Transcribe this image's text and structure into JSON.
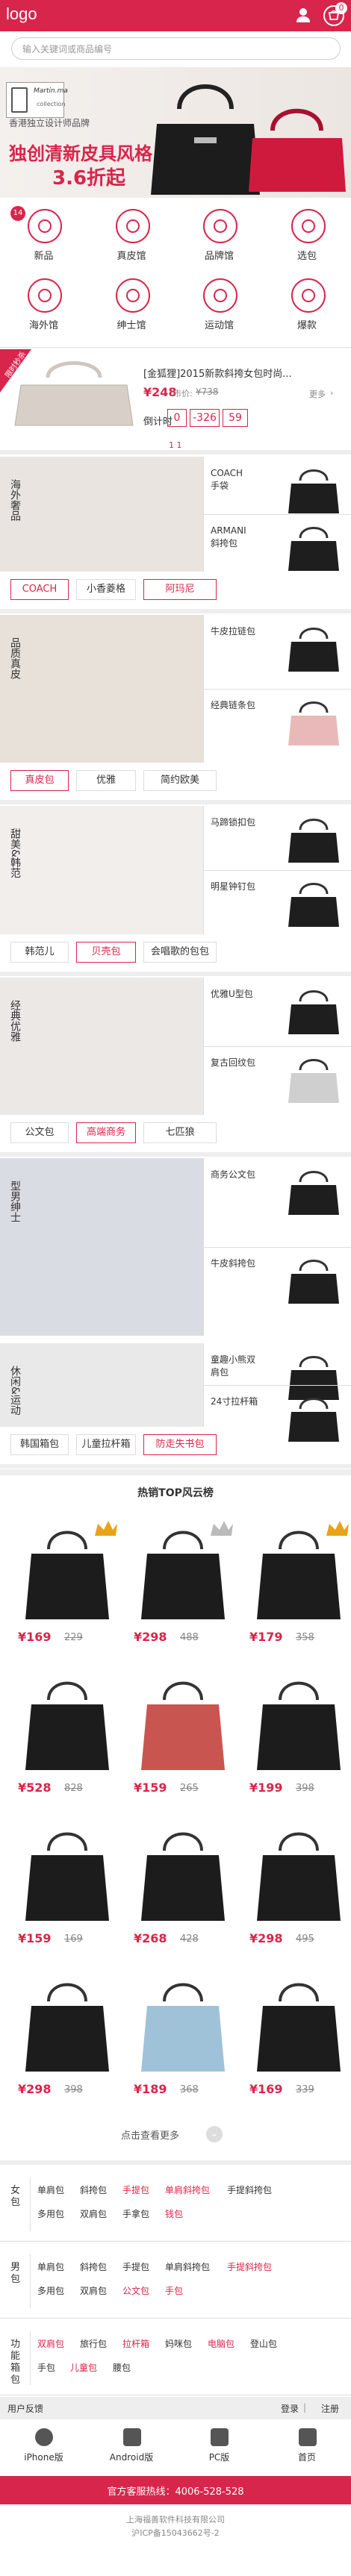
{
  "header": {
    "logo": "logo",
    "cart_count": "0",
    "search_placeholder": "输入关键词或商品编号"
  },
  "banner": {
    "brand_name": "Martin.ma",
    "brand_sub": "collection",
    "subtitle": "香港独立设计师品牌",
    "title": "独创清新皮具风格",
    "discount": "3.6折起"
  },
  "categories": [
    {
      "label": "新品",
      "badge": "14",
      "icon": "new-icon"
    },
    {
      "label": "真皮馆",
      "icon": "leather-bag-icon"
    },
    {
      "label": "品牌馆",
      "icon": "tag-icon"
    },
    {
      "label": "选包",
      "icon": "bag-select-icon"
    },
    {
      "label": "海外馆",
      "icon": "diamond-icon"
    },
    {
      "label": "绅士馆",
      "icon": "mustache-icon"
    },
    {
      "label": "运动馆",
      "icon": "sport-icon"
    },
    {
      "label": "爆款",
      "icon": "hot-icon"
    }
  ],
  "flash": {
    "tag": "限时秒杀",
    "title": "[金狐狸]2015新款斜挎女包时尚...",
    "price": "¥248",
    "old_price": "¥738",
    "more": "更多",
    "countdown_label": "倒计时",
    "countdown": [
      "0",
      "-326",
      "59"
    ],
    "pager": "1 1"
  },
  "blocks": [
    {
      "side": "海外奢品",
      "items": [
        {
          "name": "COACH\n手袋"
        },
        {
          "name": "ARMANI\n斜挎包"
        }
      ],
      "tags": [
        "COACH",
        "小香菱格",
        "阿玛尼"
      ],
      "active": [
        0,
        2
      ]
    },
    {
      "side": "品质真皮",
      "items": [
        {
          "name": "牛皮拉链包"
        },
        {
          "name": "经典链条包"
        }
      ],
      "tags": [
        "真皮包",
        "优雅",
        "简约欧美"
      ],
      "active": [
        0
      ]
    },
    {
      "side": "甜美&韩范",
      "items": [
        {
          "name": "马蹄锁扣包"
        },
        {
          "name": "明星钟钉包"
        }
      ],
      "tags": [
        "韩范儿",
        "贝壳包",
        "会唱歌的包包"
      ],
      "active": [
        1
      ]
    },
    {
      "side": "经典优雅",
      "items": [
        {
          "name": "优雅U型包"
        },
        {
          "name": "复古回纹包"
        }
      ],
      "tags": [
        "公文包",
        "高端商务",
        "七匹狼"
      ],
      "active": [
        1
      ]
    },
    {
      "side": "型男绅士",
      "items": [
        {
          "name": "商务公文包"
        },
        {
          "name": "牛皮斜挎包"
        }
      ],
      "tags": [],
      "active": []
    },
    {
      "side": "休闲&运动",
      "items": [
        {
          "name": "童趣小熊双肩包"
        },
        {
          "name": "24寸拉杆箱"
        }
      ],
      "tags": [
        "韩国箱包",
        "儿童拉杆箱",
        "防走失书包"
      ],
      "active": [
        2
      ]
    }
  ],
  "hot": {
    "title": "热销TOP风云榜",
    "products": [
      {
        "price": "¥169",
        "old": "229"
      },
      {
        "price": "¥298",
        "old": "488"
      },
      {
        "price": "¥179",
        "old": "358"
      },
      {
        "price": "¥528",
        "old": "828"
      },
      {
        "price": "¥159",
        "old": "265"
      },
      {
        "price": "¥199",
        "old": "398"
      },
      {
        "price": "¥159",
        "old": "169"
      },
      {
        "price": "¥268",
        "old": "428"
      },
      {
        "price": "¥298",
        "old": "495"
      },
      {
        "price": "¥298",
        "old": "398"
      },
      {
        "price": "¥189",
        "old": "368"
      },
      {
        "price": "¥169",
        "old": "339"
      }
    ],
    "more": "点击查看更多"
  },
  "footer_cats": [
    {
      "title": "女包",
      "links": [
        [
          "单肩包",
          "斜挎包",
          "手提包",
          "单肩斜挎包",
          "手提斜挎包"
        ],
        [
          "多用包",
          "双肩包",
          "手拿包",
          "钱包"
        ]
      ],
      "active": [
        [
          2,
          3
        ],
        [
          3
        ]
      ]
    },
    {
      "title": "男包",
      "links": [
        [
          "单肩包",
          "斜挎包",
          "手提包",
          "单肩斜挎包",
          "手提斜挎包"
        ],
        [
          "多用包",
          "双肩包",
          "公文包",
          "手包"
        ]
      ],
      "active": [
        [
          4
        ],
        [
          2,
          3
        ]
      ]
    },
    {
      "title": "功能箱包",
      "links": [
        [
          "双肩包",
          "旅行包",
          "拉杆箱",
          "妈咪包",
          "电脑包",
          "登山包"
        ],
        [
          "手包",
          "儿童包",
          "腰包"
        ]
      ],
      "active": [
        [
          0,
          2,
          4
        ],
        [
          1
        ]
      ]
    }
  ],
  "user_bar": {
    "left": "用户反馈",
    "login": "登录",
    "reg": "注册"
  },
  "apps": [
    {
      "label": "iPhone版",
      "icon": "apple-icon"
    },
    {
      "label": "Android版",
      "icon": "android-icon"
    },
    {
      "label": "PC版",
      "icon": "pc-icon"
    },
    {
      "label": "首页",
      "icon": "home-icon"
    }
  ],
  "service": "官方客服热线：4006-528-528",
  "company": "上海福善软件科技有限公司",
  "icp": "沪ICP备15043662号-2"
}
